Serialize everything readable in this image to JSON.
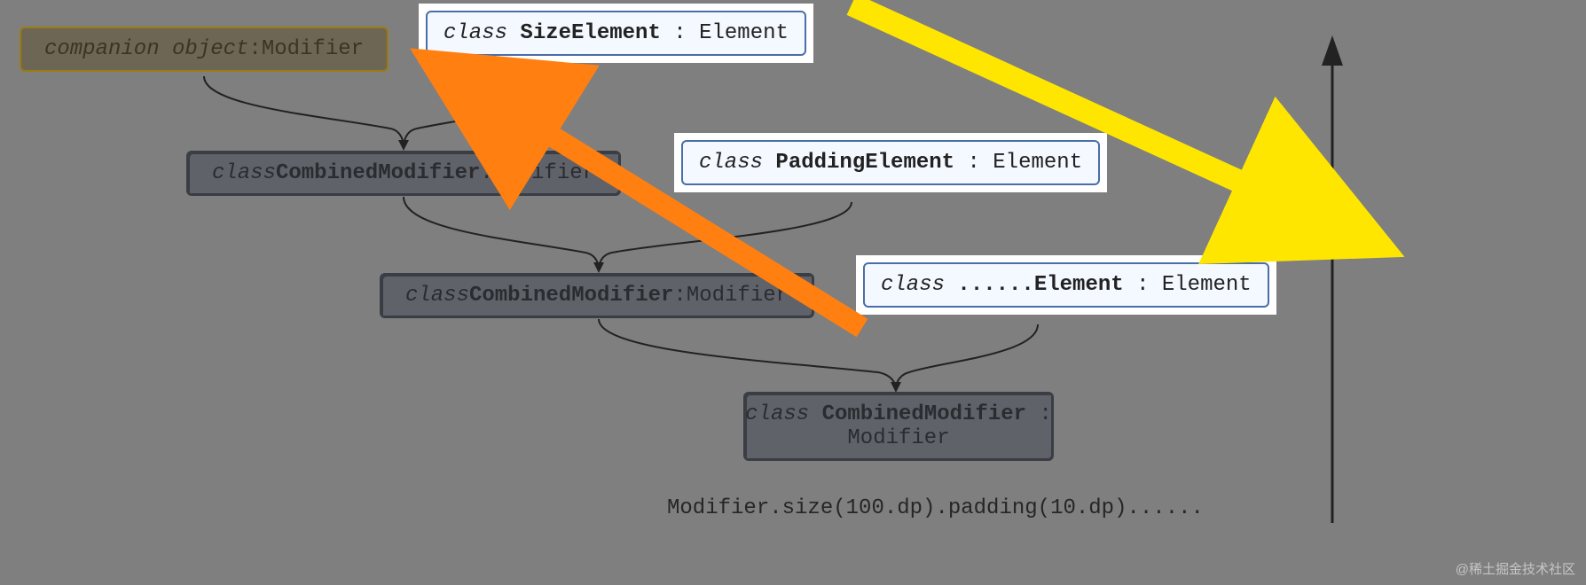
{
  "nodes": {
    "companion": {
      "kw": "companion object",
      "sep": " : ",
      "type": "Modifier"
    },
    "size_elem": {
      "kw": "class ",
      "name": "SizeElement",
      "sep": ": ",
      "type": "Element"
    },
    "combined1": {
      "kw": "class ",
      "name": "CombinedModifier",
      "sep": ": ",
      "type": "Modifier"
    },
    "padding_elem": {
      "kw": "class ",
      "name": "PaddingElement",
      "sep": ": ",
      "type": "Element"
    },
    "combined2": {
      "kw": "class ",
      "name": "CombinedModifier",
      "sep": ": ",
      "type": "Modifier"
    },
    "generic_elem": {
      "kw": "class ",
      "name": "......Element",
      "sep": ": ",
      "type": "Element"
    },
    "combined3": {
      "kw": "class ",
      "name": "CombinedModifier",
      "sep": ":",
      "type": "Modifier"
    }
  },
  "code_line": "Modifier.size(100.dp).padding(10.dp)......",
  "watermark": "@稀土掘金技术社区"
}
